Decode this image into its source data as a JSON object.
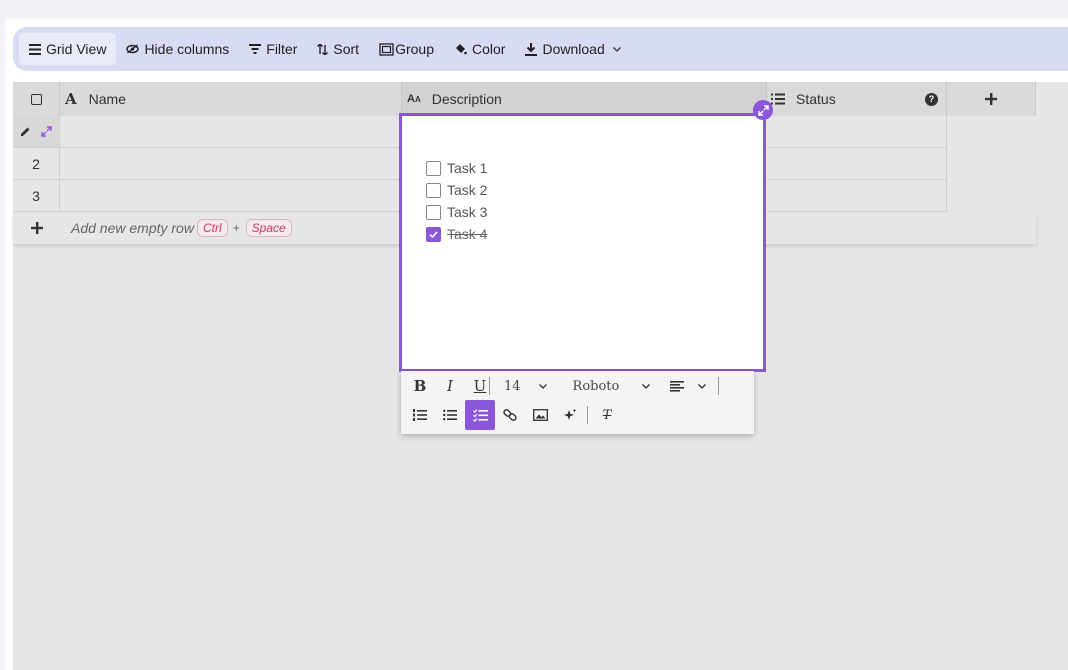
{
  "toolbar": {
    "grid_view": "Grid View",
    "hide_columns": "Hide columns",
    "filter": "Filter",
    "sort": "Sort",
    "group": "Group",
    "color": "Color",
    "download": "Download"
  },
  "columns": [
    {
      "name": "Name",
      "icon": "text-type-icon"
    },
    {
      "name": "Description",
      "icon": "long-text-icon"
    },
    {
      "name": "Status",
      "icon": "list-icon"
    }
  ],
  "rows": [
    {
      "number": ""
    },
    {
      "number": "2"
    },
    {
      "number": "3"
    }
  ],
  "add_row": {
    "label": "Add new empty row",
    "key1": "Ctrl",
    "plus": "+",
    "key2": "Space"
  },
  "editor": {
    "tasks": [
      {
        "label": "Task 1",
        "checked": false
      },
      {
        "label": "Task 2",
        "checked": false
      },
      {
        "label": "Task 3",
        "checked": false
      },
      {
        "label": "Task 4",
        "checked": true
      }
    ],
    "font_size": "14",
    "font_family": "Roboto",
    "bold": "B",
    "italic": "I",
    "underline": "U",
    "clear_format": "T"
  },
  "colors": {
    "accent": "#8b57d9",
    "toolbar_bg": "#d8dbf4",
    "grid_bg": "#e6e6e6",
    "header_bg": "#dadada"
  }
}
